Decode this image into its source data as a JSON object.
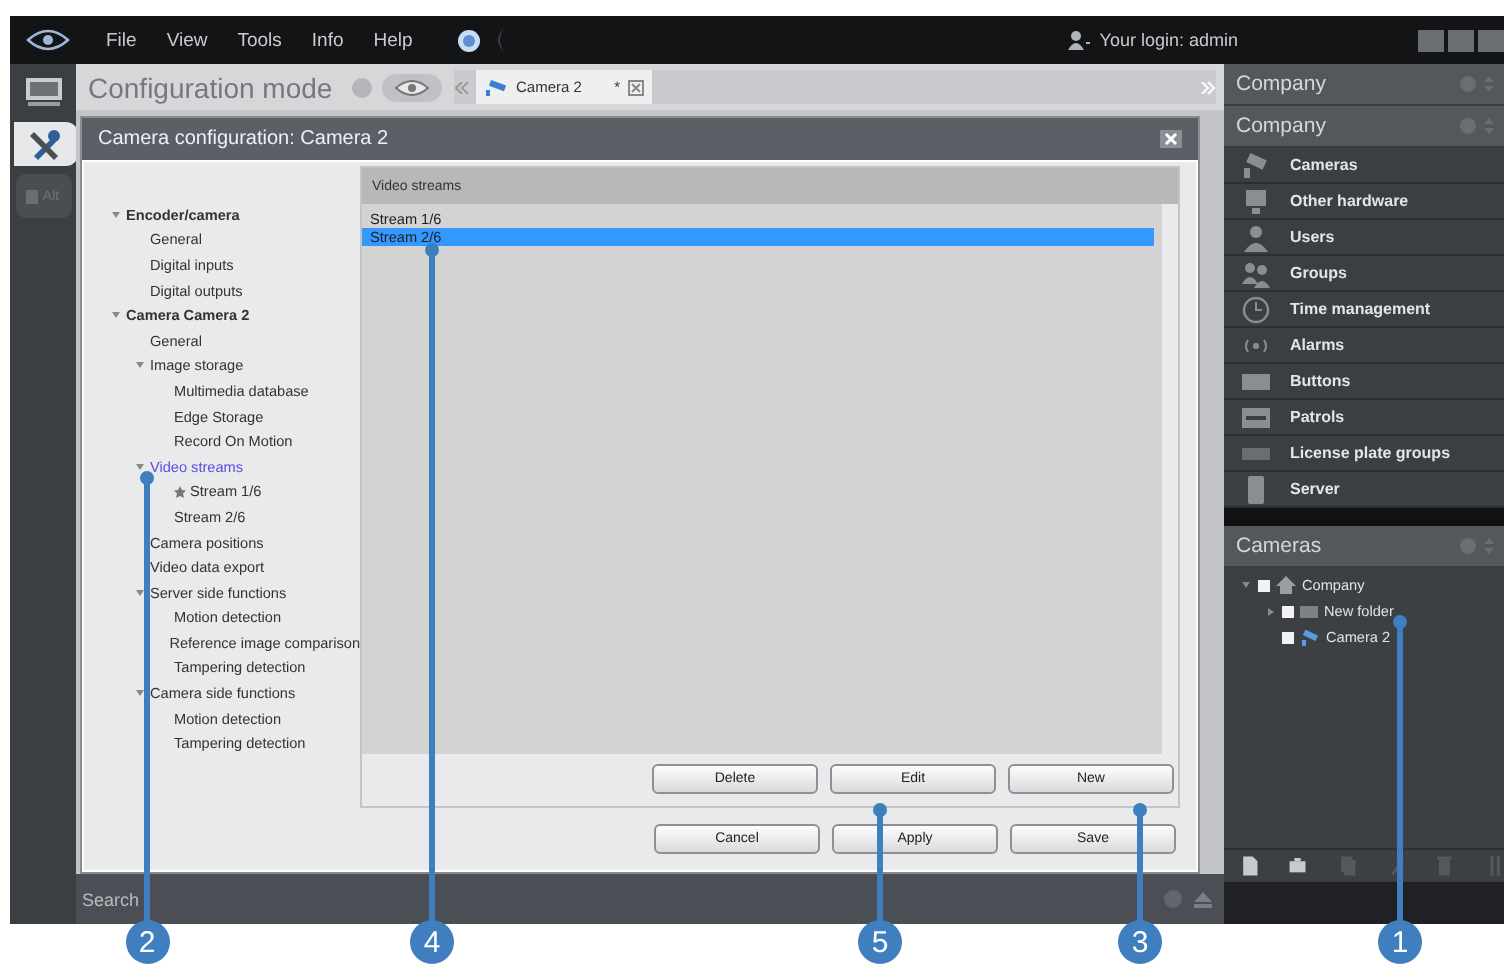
{
  "menu_bar": {
    "items": [
      "File",
      "View",
      "Tools",
      "Info",
      "Help"
    ],
    "login": "Your login: admin"
  },
  "rail": [
    {
      "kind": "monitor",
      "selected": false
    },
    {
      "kind": "tools",
      "selected": true
    },
    {
      "kind": "alt",
      "label": "Alt",
      "selected": false
    }
  ],
  "header": {
    "title": "Configuration mode",
    "tab": {
      "label": "Camera 2",
      "mark": "*"
    }
  },
  "dialog": {
    "title": "Camera configuration: Camera 2",
    "tree": [
      {
        "label": "Encoder/camera",
        "selected": false,
        "expanded": true,
        "children": [
          {
            "label": "General",
            "selected": false
          },
          {
            "label": "Digital inputs",
            "selected": false
          },
          {
            "label": "Digital outputs",
            "selected": false
          }
        ]
      },
      {
        "label": "Camera Camera 2",
        "selected": false,
        "expanded": true,
        "children": [
          {
            "label": "General",
            "selected": false
          },
          {
            "label": "Image storage",
            "selected": false,
            "expanded": true,
            "children": [
              {
                "label": "Multimedia database",
                "selected": false
              },
              {
                "label": "Edge Storage",
                "selected": false
              },
              {
                "label": "Record On Motion",
                "selected": false
              }
            ]
          },
          {
            "label": "Video streams",
            "selected": true,
            "expanded": true,
            "children": [
              {
                "label": "Stream 1/6",
                "selected": false,
                "primary": true
              },
              {
                "label": "Stream 2/6",
                "selected": false,
                "primary": false
              }
            ]
          },
          {
            "label": "Camera positions",
            "selected": false
          },
          {
            "label": "Video data export",
            "selected": false
          },
          {
            "label": "Server side functions",
            "selected": false,
            "expanded": true,
            "children": [
              {
                "label": "Motion detection",
                "selected": false
              },
              {
                "label": "Reference image comparison",
                "selected": false
              },
              {
                "label": "Tampering detection",
                "selected": false
              }
            ]
          },
          {
            "label": "Camera side functions",
            "selected": false,
            "expanded": true,
            "children": [
              {
                "label": "Motion detection",
                "selected": false
              },
              {
                "label": "Tampering detection",
                "selected": false
              }
            ]
          }
        ]
      }
    ],
    "panel": {
      "title": "Video streams",
      "streams": [
        {
          "label": "Stream 1/6",
          "selected": false
        },
        {
          "label": "Stream 2/6",
          "selected": true
        }
      ],
      "buttons": [
        "Delete",
        "Edit",
        "New"
      ]
    },
    "buttons": [
      "Cancel",
      "Apply",
      "Save"
    ]
  },
  "search_bar": {
    "title": "Search"
  },
  "sidebar": {
    "title": "Company",
    "section": "Company",
    "items": [
      {
        "kind": "cameras",
        "label": "Cameras"
      },
      {
        "kind": "hardware",
        "label": "Other hardware"
      },
      {
        "kind": "users",
        "label": "Users"
      },
      {
        "kind": "groups",
        "label": "Groups"
      },
      {
        "kind": "time",
        "label": "Time management"
      },
      {
        "kind": "alarms",
        "label": "Alarms"
      },
      {
        "kind": "buttons",
        "label": "Buttons"
      },
      {
        "kind": "patrols",
        "label": "Patrols"
      },
      {
        "kind": "plates",
        "label": "License plate groups"
      },
      {
        "kind": "server",
        "label": "Server"
      }
    ],
    "cameras": {
      "title": "Cameras",
      "tree": [
        {
          "kind": "home",
          "label": "Company",
          "checked": false,
          "expanded": true,
          "children": [
            {
              "kind": "folder",
              "label": "New folder",
              "checked": false,
              "expanded": false
            },
            {
              "kind": "camera",
              "label": "Camera 2",
              "checked": false
            }
          ]
        }
      ],
      "toolbar": [
        {
          "kind": "add",
          "disabled": false
        },
        {
          "kind": "camera",
          "disabled": false
        },
        {
          "kind": "copy",
          "disabled": true
        },
        {
          "kind": "edit",
          "disabled": true
        },
        {
          "kind": "delete",
          "disabled": true
        },
        {
          "kind": "sort",
          "disabled": true
        }
      ]
    }
  },
  "callouts": [
    {
      "number": "2"
    },
    {
      "number": "4"
    },
    {
      "number": "5"
    },
    {
      "number": "3"
    },
    {
      "number": "1"
    }
  ]
}
